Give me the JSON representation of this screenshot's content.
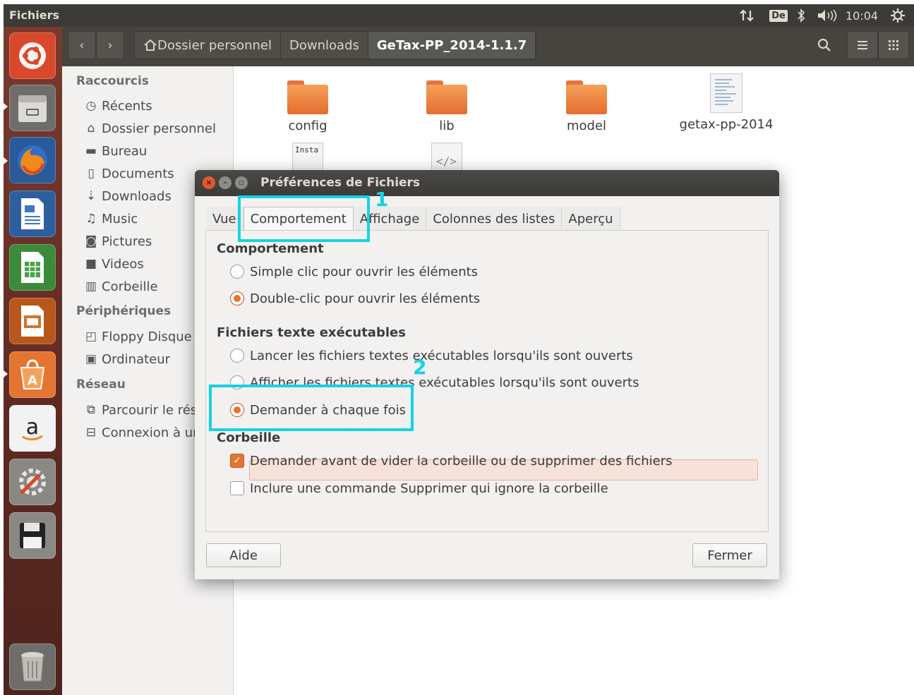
{
  "app_title": "Fichiers",
  "panel": {
    "keyboard_layout": "De",
    "clock": "10:04",
    "icons": [
      "network-icon",
      "bluetooth-icon",
      "volume-icon",
      "settings-icon"
    ]
  },
  "launcher": {
    "items": [
      "ubuntu-dash-icon",
      "files-icon",
      "firefox-icon",
      "writer-icon",
      "calc-icon",
      "impress-icon",
      "software-center-icon",
      "amazon-icon",
      "system-settings-icon",
      "save-icon",
      "trash-icon"
    ]
  },
  "headerbar": {
    "back": "‹",
    "forward": "›",
    "breadcrumbs": [
      {
        "label": "Dossier personnel",
        "active": false
      },
      {
        "label": "Downloads",
        "active": false
      },
      {
        "label": "GeTax-PP_2014-1.1.7",
        "active": true
      }
    ]
  },
  "sidebar": {
    "sections": [
      {
        "title": "Raccourcis",
        "items": [
          "Récents",
          "Dossier personnel",
          "Bureau",
          "Documents",
          "Downloads",
          "Music",
          "Pictures",
          "Videos",
          "Corbeille"
        ]
      },
      {
        "title": "Périphériques",
        "items": [
          "Floppy Disque",
          "Ordinateur"
        ]
      },
      {
        "title": "Réseau",
        "items": [
          "Parcourir le réseau",
          "Connexion à un serveur"
        ]
      }
    ]
  },
  "files": [
    {
      "name": "config",
      "type": "folder"
    },
    {
      "name": "lib",
      "type": "folder"
    },
    {
      "name": "model",
      "type": "folder"
    },
    {
      "name": "getax-pp-2014",
      "type": "document"
    },
    {
      "name": "",
      "type": "text-file",
      "preview": "Insta"
    },
    {
      "name": "",
      "type": "xml-file",
      "preview": "</>"
    }
  ],
  "dialog": {
    "title": "Préférences de Fichiers",
    "tabs": [
      {
        "label": "Vue",
        "active": false
      },
      {
        "label": "Comportement",
        "active": true
      },
      {
        "label": "Affichage",
        "active": false
      },
      {
        "label": "Colonnes des listes",
        "active": false
      },
      {
        "label": "Aperçu",
        "active": false
      }
    ],
    "sections": {
      "behavior": {
        "title": "Comportement",
        "options": [
          {
            "label": "Simple clic pour ouvrir les éléments",
            "checked": false
          },
          {
            "label": "Double-clic pour ouvrir les éléments",
            "checked": true
          }
        ]
      },
      "executables": {
        "title": "Fichiers texte exécutables",
        "options": [
          {
            "label": "Lancer les fichiers textes exécutables lorsqu'ils sont ouverts",
            "checked": false
          },
          {
            "label": "Afficher les fichiers textes exécutables lorsqu'ils sont ouverts",
            "checked": false
          },
          {
            "label": "Demander à chaque fois",
            "checked": true
          }
        ]
      },
      "trash": {
        "title": "Corbeille",
        "options": [
          {
            "label": "Demander avant de vider la corbeille ou de supprimer des fichiers",
            "checked": true
          },
          {
            "label": "Inclure une commande Supprimer qui ignore la corbeille",
            "checked": false
          }
        ]
      }
    },
    "buttons": {
      "help": "Aide",
      "close": "Fermer"
    }
  },
  "annotations": {
    "marker_1": "1",
    "marker_2": "2",
    "color": "#14d3e6"
  },
  "colors": {
    "accent": "#e4742f",
    "panel": "#3c3b37",
    "launcher": "#5c2a22"
  }
}
